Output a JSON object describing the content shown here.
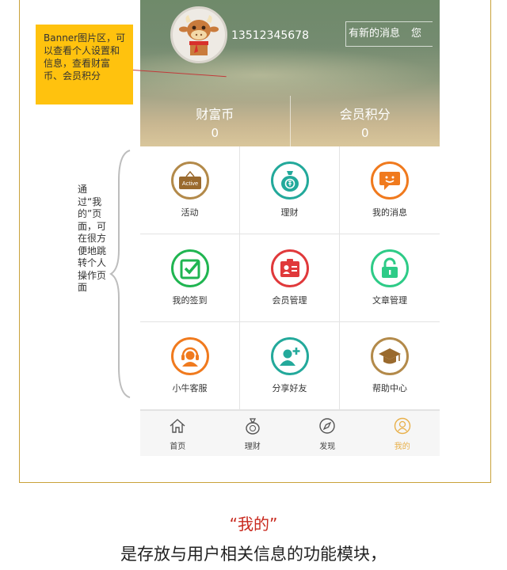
{
  "callout": {
    "text": "Banner图片区，可以查看个人设置和信息，查看财富币、会员积分"
  },
  "side_note": {
    "text": "通过“我的”页面，可在很方便地跳转个人操作页面"
  },
  "profile": {
    "phone": "13512345678",
    "message_notice": "有新的消息",
    "message_tail": "您"
  },
  "stats": [
    {
      "label": "财富币",
      "value": "0"
    },
    {
      "label": "会员积分",
      "value": "0"
    }
  ],
  "grid": [
    {
      "label": "活动",
      "icon": "active-badge-icon",
      "color": "#b38a4a",
      "badge": "Active"
    },
    {
      "label": "理财",
      "icon": "money-bag-icon",
      "color": "#23a99b"
    },
    {
      "label": "我的消息",
      "icon": "chat-bubble-icon",
      "color": "#f07a1e"
    },
    {
      "label": "我的签到",
      "icon": "checkbox-icon",
      "color": "#20b551"
    },
    {
      "label": "会员管理",
      "icon": "member-card-icon",
      "color": "#e0393b"
    },
    {
      "label": "文章管理",
      "icon": "lock-icon",
      "color": "#2ecb87"
    },
    {
      "label": "小牛客服",
      "icon": "headset-agent-icon",
      "color": "#f07a1e"
    },
    {
      "label": "分享好友",
      "icon": "add-friend-icon",
      "color": "#23a99b"
    },
    {
      "label": "帮助中心",
      "icon": "graduation-cap-icon",
      "color": "#b38a4a"
    }
  ],
  "tabs": [
    {
      "label": "首页",
      "icon": "home-icon",
      "active": false
    },
    {
      "label": "理财",
      "icon": "money-bag-icon",
      "active": false
    },
    {
      "label": "发现",
      "icon": "compass-icon",
      "active": false
    },
    {
      "label": "我的",
      "icon": "user-icon",
      "active": true
    }
  ],
  "caption": {
    "title": "“我的”",
    "subtitle": "是存放与用户相关信息的功能模块，"
  },
  "colors": {
    "frame": "#c9a23a",
    "callout_bg": "#ffc20e",
    "active_tab": "#e8b04a",
    "caption_title": "#c8281d"
  }
}
